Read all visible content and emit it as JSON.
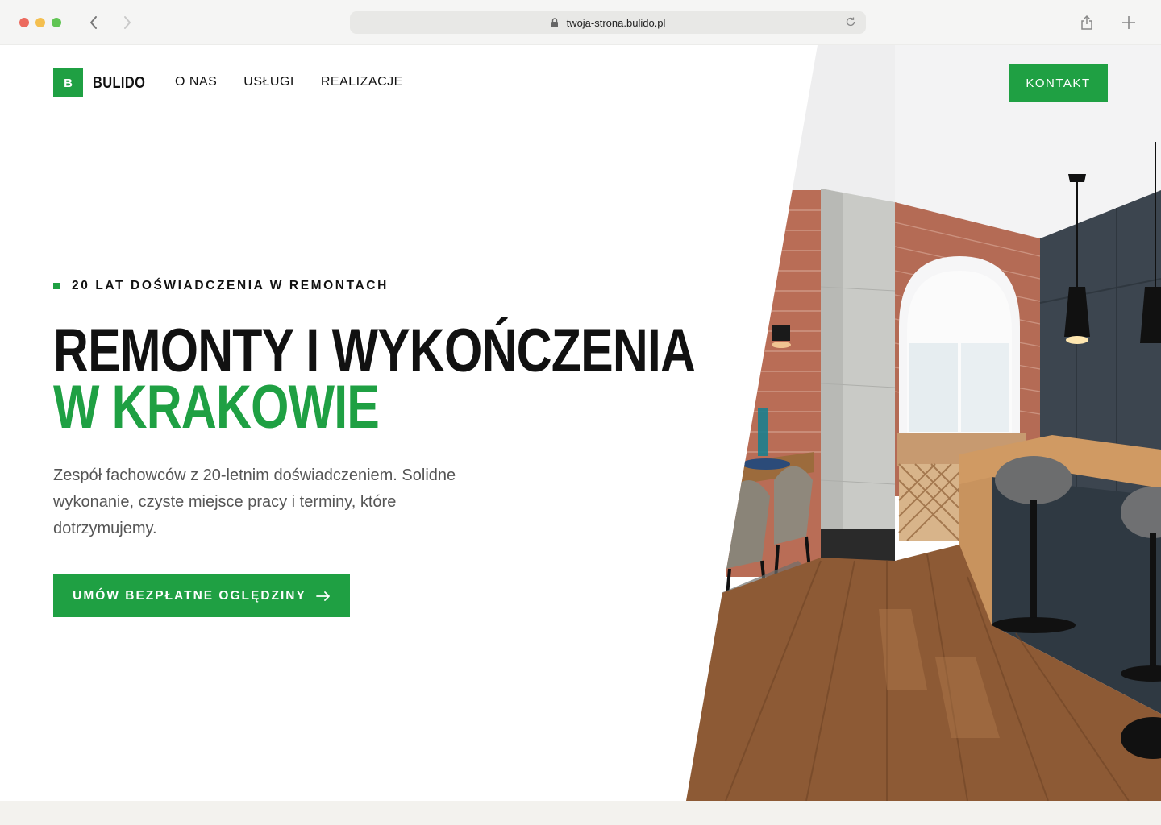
{
  "browser": {
    "url": "twoja-strona.bulido.pl"
  },
  "header": {
    "logo_letter": "B",
    "brand": "BULIDO",
    "nav": [
      "O NAS",
      "USŁUGI",
      "REALIZACJE"
    ],
    "cta": "KONTAKT"
  },
  "hero": {
    "eyebrow": "20 LAT DOŚWIADCZENIA W REMONTACH",
    "title_line1": "REMONTY I WYKOŃCZENIA",
    "title_line2": "W KRAKOWIE",
    "description": "Zespół fachowców z 20-letnim doświadczeniem. Solidne wykonanie, czyste miejsce pracy i terminy, które dotrzymujemy.",
    "cta": "UMÓW BEZPŁATNE OGLĘDZINY",
    "image": "interior-kitchen-photo"
  },
  "colors": {
    "brand_green": "#1fa043",
    "text_dark": "#111111",
    "text_muted": "#555555"
  }
}
